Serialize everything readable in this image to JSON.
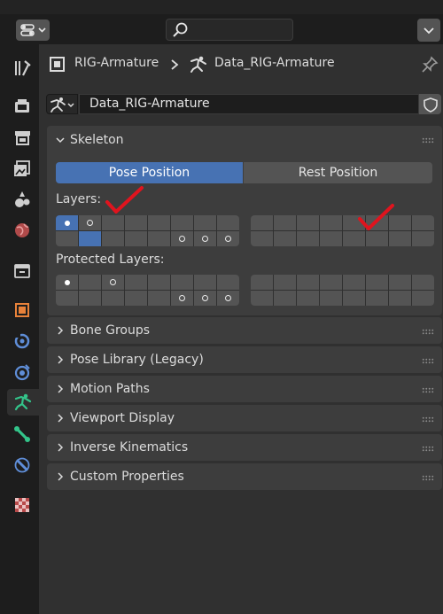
{
  "header": {
    "editor_type_icon": "properties-editor-icon",
    "search": {
      "placeholder": ""
    }
  },
  "tabs": [
    {
      "icon": "tool-icon",
      "active": false
    },
    {
      "icon": "render-icon",
      "active": false
    },
    {
      "icon": "output-icon",
      "active": false
    },
    {
      "icon": "view-layer-icon",
      "active": false
    },
    {
      "icon": "scene-icon",
      "active": false
    },
    {
      "icon": "world-icon",
      "active": false
    },
    {
      "icon": "collection-icon",
      "active": false
    },
    {
      "icon": "object-icon",
      "active": false
    },
    {
      "icon": "modifier-icon",
      "active": false
    },
    {
      "icon": "physics-icon",
      "active": false
    },
    {
      "icon": "armature-data-icon",
      "active": true
    },
    {
      "icon": "bone-icon",
      "active": false
    },
    {
      "icon": "bone-constraint-icon",
      "active": false
    },
    {
      "icon": "texture-icon",
      "active": false
    }
  ],
  "breadcrumb": {
    "object_name": "RIG-Armature",
    "data_name": "Data_RIG-Armature"
  },
  "datablock": {
    "name": "Data_RIG-Armature"
  },
  "skeleton": {
    "title": "Skeleton",
    "pose_position": "Pose Position",
    "rest_position": "Rest Position",
    "layers_label": "Layers:",
    "protected_label": "Protected Layers:",
    "layers": {
      "active": [
        0,
        17
      ],
      "with_bones": [
        0,
        1,
        21,
        22,
        23
      ]
    },
    "protected": {
      "with_bones": [
        0,
        2,
        21,
        22,
        23
      ]
    }
  },
  "panels": [
    {
      "title": "Bone Groups"
    },
    {
      "title": "Pose Library (Legacy)"
    },
    {
      "title": "Motion Paths"
    },
    {
      "title": "Viewport Display"
    },
    {
      "title": "Inverse Kinematics"
    },
    {
      "title": "Custom Properties"
    }
  ],
  "colors": {
    "accent": "#4772b3",
    "annotation_check": "#e0141e"
  }
}
